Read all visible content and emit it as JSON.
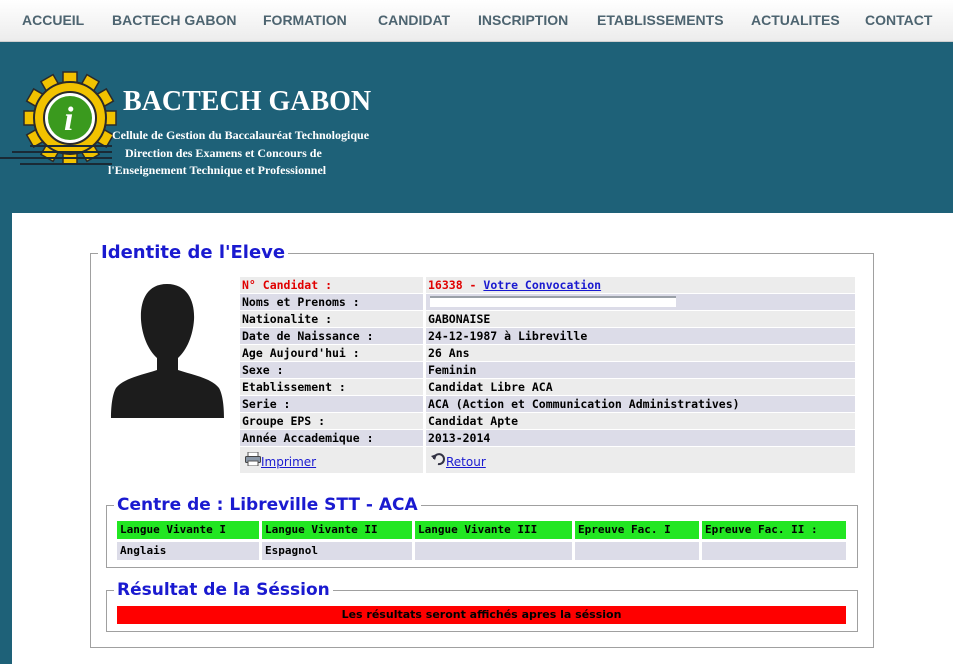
{
  "nav": [
    "ACCUEIL",
    "BACTECH GABON",
    "FORMATION",
    "CANDIDAT",
    "INSCRIPTION",
    "ETABLISSEMENTS",
    "ACTUALITES",
    "CONTACT"
  ],
  "header": {
    "title": "BACTECH GABON",
    "sub1": "Cellule de Gestion du Baccalauréat Technologique",
    "sub2": "Direction des Examens et Concours de",
    "sub3": "l'Enseignement Technique et Professionnel"
  },
  "identity": {
    "legend": "Identite de l'Eleve",
    "rows": [
      {
        "label": "N° Candidat :",
        "value": "16338 - "
      },
      {
        "label": "Noms et Prenoms :",
        "value": ""
      },
      {
        "label": "Nationalite :",
        "value": "GABONAISE"
      },
      {
        "label": "Date de Naissance :",
        "value": "24-12-1987 à Libreville"
      },
      {
        "label": "Age Aujourd'hui :",
        "value": "26 Ans"
      },
      {
        "label": "Sexe :",
        "value": "Feminin"
      },
      {
        "label": "Etablissement :",
        "value": "Candidat Libre ACA"
      },
      {
        "label": "Serie :",
        "value": "ACA (Action et Communication Administratives)"
      },
      {
        "label": "Groupe EPS :",
        "value": "Candidat Apte"
      },
      {
        "label": "Année Accademique :",
        "value": "2013-2014"
      }
    ],
    "convocation_link": "Votre Convocation",
    "print_label": "Imprimer",
    "back_label": "Retour"
  },
  "centre": {
    "legend": "Centre de : Libreville STT - ACA",
    "headers": [
      "Langue Vivante I",
      "Langue Vivante II",
      "Langue Vivante III",
      "Epreuve Fac. I",
      "Epreuve Fac. II :"
    ],
    "values": [
      "Anglais",
      "Espagnol",
      "",
      "",
      ""
    ]
  },
  "result": {
    "legend": "Résultat de la Séssion",
    "message": "Les résultats seront affichés apres la séssion"
  },
  "colors": {
    "banner": "#1e6178",
    "legend": "#1a1ad0",
    "grid_header": "#22e622",
    "result_bar": "#ff0000"
  }
}
